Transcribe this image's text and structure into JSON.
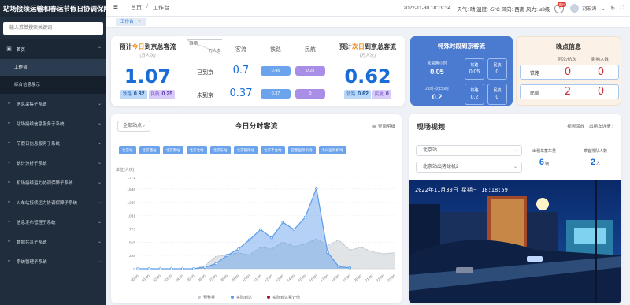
{
  "app": {
    "title": "站场接续运输和春运节假日协调保障系统"
  },
  "sidebar": {
    "search_placeholder": "输入菜单搜索关键词",
    "home": {
      "label": "首页"
    },
    "home_children": [
      {
        "label": "工作台",
        "active": true
      },
      {
        "label": "综合信息展示",
        "active": false
      }
    ],
    "items": [
      {
        "label": "信息采集子系统"
      },
      {
        "label": "站场接续信息服务子系统"
      },
      {
        "label": "节假日信息服务子系统"
      },
      {
        "label": "统计分析子系统"
      },
      {
        "label": "机场接续运力协调保障子系统"
      },
      {
        "label": "火车站接续运力协调保障子系统"
      },
      {
        "label": "信息发布管理子系统"
      },
      {
        "label": "数据共享子系统"
      },
      {
        "label": "系统管理子系统"
      }
    ]
  },
  "topbar": {
    "breadcrumb": [
      "首页",
      "工作台"
    ],
    "datetime": "2022-11-30 18:19:34",
    "weather": "天气: 晴 温度: -5°C 风向: 西南 风力: ≤3级",
    "notification_count": "99+",
    "user_name": "刘宏涛"
  },
  "tags": {
    "active": "工作台"
  },
  "today_forecast": {
    "title_pre": "预计",
    "title_hl": "今日",
    "title_post": "到京总客流",
    "unit": "(万人次)",
    "total": "1.07",
    "rail_label": "铁路",
    "rail_value": "0.82",
    "air_label": "民航",
    "air_value": "0.25"
  },
  "passenger_table": {
    "corner_top": "事项",
    "corner_bottom": "万人次",
    "headers": [
      "客流",
      "铁路",
      "民航"
    ],
    "rows": [
      {
        "label": "已到京",
        "total": "0.7",
        "rail": "0.45",
        "air": "0.25"
      },
      {
        "label": "未到京",
        "total": "0.37",
        "rail": "0.37",
        "air": "0"
      }
    ]
  },
  "tomorrow_forecast": {
    "title_pre": "预计",
    "title_hl": "次日",
    "title_post": "到京总客流",
    "unit": "(万人次)",
    "total": "0.62",
    "rail_label": "铁路",
    "rail_value": "0.62",
    "air_label": "民航",
    "air_value": "0"
  },
  "special_period": {
    "title": "特殊时段到京客流",
    "rows": [
      {
        "label": "未来两小时",
        "total": "0.05",
        "rail_label": "铁路",
        "rail": "0.05",
        "air_label": "民航",
        "air": "0"
      },
      {
        "label": "21时-次日5时",
        "total": "0.2",
        "rail_label": "铁路",
        "rail": "0.2",
        "air_label": "民航",
        "air": "0"
      }
    ]
  },
  "night_info": {
    "title": "晚点信息",
    "headers": [
      "列次/航次",
      "影响人数"
    ],
    "rows": [
      {
        "label": "铁路",
        "count": "0",
        "people": "0"
      },
      {
        "label": "民航",
        "count": "2",
        "people": "0"
      }
    ]
  },
  "chart_card": {
    "filter": "全部站点",
    "title": "今日分时客流",
    "link": "查阅明细",
    "site_tabs": [
      "北京站",
      "北京西站",
      "北京南站",
      "北京北站",
      "北京东站",
      "北京朝阳站",
      "北京丰台站",
      "首都国际机场",
      "大兴国际机场"
    ]
  },
  "chart_data": {
    "type": "area",
    "ylabel": "单位(人次)",
    "yticks": [
      0,
      258,
      515,
      773,
      1031,
      1289,
      1546,
      1772
    ],
    "ylim": [
      0,
      1772
    ],
    "x": [
      "00:00",
      "01:00",
      "02:00",
      "03:00",
      "04:00",
      "05:00",
      "06:00",
      "07:00",
      "08:00",
      "09:00",
      "10:00",
      "11:00",
      "12:00",
      "13:00",
      "14:00",
      "15:00",
      "16:00",
      "17:00",
      "18:00",
      "19:00",
      "20:00",
      "21:00",
      "22:00",
      "23:00"
    ],
    "series": [
      {
        "name": "预整量",
        "color": "#c8cdd4",
        "values": [
          0,
          0,
          0,
          0,
          0,
          0,
          60,
          240,
          270,
          310,
          270,
          420,
          380,
          520,
          430,
          480,
          580,
          450,
          560,
          360,
          420,
          330,
          290,
          310
        ]
      },
      {
        "name": "实际到达",
        "color": "#5b9bea",
        "values": [
          0,
          0,
          0,
          0,
          0,
          0,
          30,
          100,
          260,
          380,
          560,
          760,
          600,
          900,
          760,
          1000,
          1560,
          320,
          40,
          20,
          null,
          null,
          null,
          null
        ]
      },
      {
        "name": "实际到达累计值",
        "color": "#9b1a3a",
        "values": []
      }
    ],
    "legend_position": "bottom"
  },
  "video": {
    "title": "现场视频",
    "links": [
      "视频回放",
      "出租车详情"
    ],
    "station_select": "北京站",
    "camera_select": "北京站出势球机2",
    "taxi_label": "出租车蓄车量",
    "taxi_value": "6",
    "taxi_unit": "辆",
    "queue_label": "乘客排队人数",
    "queue_value": "2",
    "queue_unit": "人",
    "timestamp": "2022年11月30日  星期三  18:18:59"
  }
}
